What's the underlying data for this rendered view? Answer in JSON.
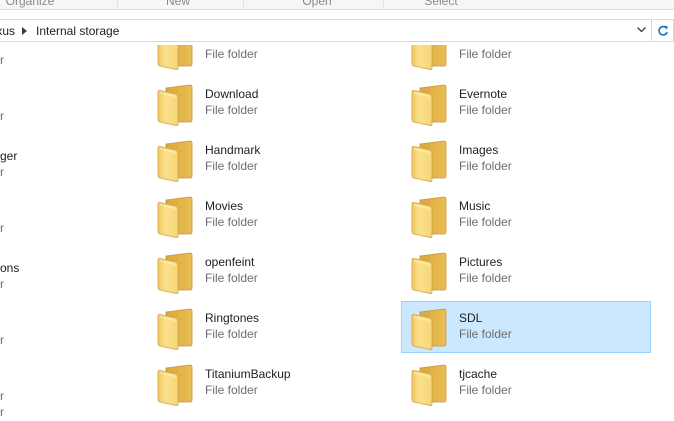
{
  "ribbon": {
    "groups": [
      "Organize",
      "New",
      "Open",
      "Select"
    ]
  },
  "address": {
    "previous": "Nexus",
    "current": "Internal storage"
  },
  "left_fragments": [
    "r",
    "r",
    "ger",
    "r",
    "r",
    "ons",
    "r",
    "r",
    "r",
    "r"
  ],
  "top_row": {
    "left_type": "File folder",
    "right_type": "File folder"
  },
  "folders": [
    {
      "name": "Download",
      "type": "File folder"
    },
    {
      "name": "Evernote",
      "type": "File folder"
    },
    {
      "name": "Handmark",
      "type": "File folder"
    },
    {
      "name": "Images",
      "type": "File folder"
    },
    {
      "name": "Movies",
      "type": "File folder"
    },
    {
      "name": "Music",
      "type": "File folder"
    },
    {
      "name": "openfeint",
      "type": "File folder"
    },
    {
      "name": "Pictures",
      "type": "File folder"
    },
    {
      "name": "Ringtones",
      "type": "File folder"
    },
    {
      "name": "SDL",
      "type": "File folder",
      "selected": true
    },
    {
      "name": "TitaniumBackup",
      "type": "File folder"
    },
    {
      "name": "tjcache",
      "type": "File folder"
    }
  ],
  "colors": {
    "selection_bg": "#cce8ff",
    "selection_border": "#99d1ff",
    "folder_front": "#f8d775",
    "folder_back": "#e7b84a"
  }
}
